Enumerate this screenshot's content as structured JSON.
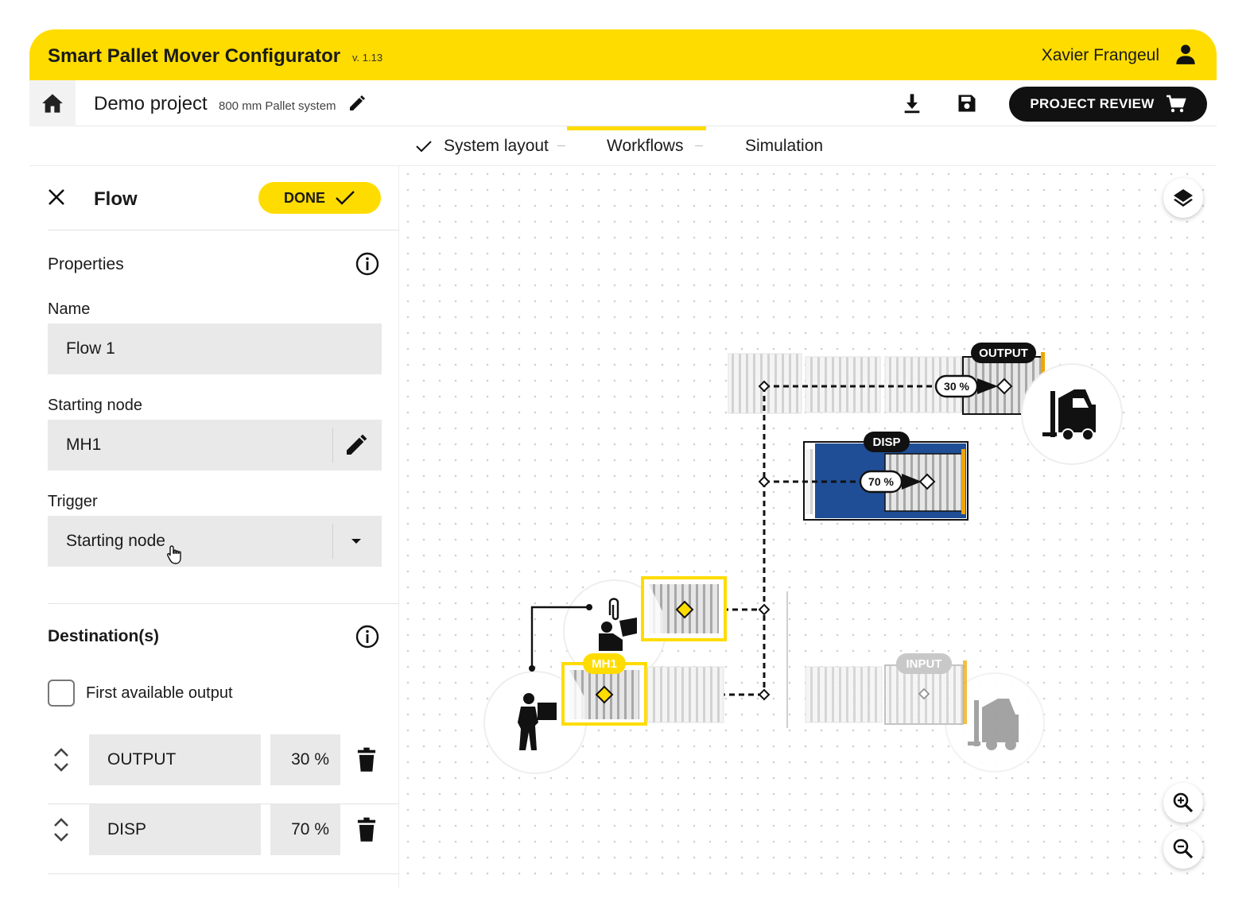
{
  "app": {
    "title": "Smart Pallet Mover Configurator",
    "version": "v. 1.13",
    "user_name": "Xavier Frangeul"
  },
  "project": {
    "name": "Demo project",
    "subtitle": "800 mm Pallet system",
    "review_label": "PROJECT REVIEW"
  },
  "tabs": [
    {
      "label": "System layout",
      "state": "completed"
    },
    {
      "label": "Workflows",
      "state": "active"
    },
    {
      "label": "Simulation",
      "state": "inactive"
    }
  ],
  "panel": {
    "title": "Flow",
    "done_label": "DONE",
    "properties_title": "Properties",
    "name_label": "Name",
    "name_value": "Flow 1",
    "starting_node_label": "Starting node",
    "starting_node_value": "MH1",
    "trigger_label": "Trigger",
    "trigger_value": "Starting node",
    "destinations_title": "Destination(s)",
    "first_available_label": "First available output",
    "first_available_checked": false,
    "destinations": [
      {
        "name": "OUTPUT",
        "percent": "30 %"
      },
      {
        "name": "DISP",
        "percent": "70 %"
      }
    ]
  },
  "diagram": {
    "output_label": "OUTPUT",
    "output_percent": "30 %",
    "disp_label": "DISP",
    "disp_percent": "70 %",
    "mh1_label": "MH1",
    "input_label": "INPUT"
  },
  "colors": {
    "brand_yellow": "#ffdc00",
    "disp_blue": "#1f4e96",
    "dark": "#111111"
  },
  "icons": {
    "home": "home-icon",
    "user": "user-icon",
    "edit": "pencil-icon",
    "download": "download-icon",
    "save": "floppy-disk-icon",
    "cart": "cart-icon",
    "close": "close-icon",
    "check": "check-icon",
    "info": "info-icon",
    "dropdown": "caret-down-icon",
    "sort": "sort-icon",
    "delete": "trash-icon",
    "layers": "layers-icon",
    "zoom_in": "zoom-in-icon",
    "zoom_out": "zoom-out-icon"
  }
}
